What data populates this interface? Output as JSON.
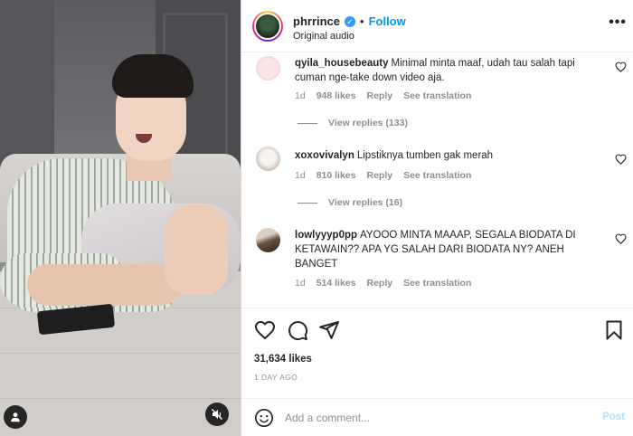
{
  "post": {
    "username": "phrrince",
    "separator": "•",
    "follow_label": "Follow",
    "audio": "Original audio",
    "more_icon": "more-horizontal-icon"
  },
  "comments": [
    {
      "username": "qyila_housebeauty",
      "text": "Minimal minta maaf, udah tau salah tapi cuman nge-take down video aja.",
      "time": "1d",
      "likes": "948 likes",
      "reply": "Reply",
      "translate": "See translation",
      "view_replies": "View replies (133)"
    },
    {
      "username": "xoxovivalyn",
      "text": "Lipstiknya tumben gak merah",
      "time": "1d",
      "likes": "810 likes",
      "reply": "Reply",
      "translate": "See translation",
      "view_replies": "View replies (16)"
    },
    {
      "username": "lowlyyyp0pp",
      "text": "AYOOO MINTA MAAAP, SEGALA BIODATA DI KETAWAIN?? APA YG SALAH DARI BIODATA NY? ANEH BANGET",
      "time": "1d",
      "likes": "514 likes",
      "reply": "Reply",
      "translate": "See translation"
    }
  ],
  "stats": {
    "likes": "31,634 likes",
    "time_ago": "1 DAY AGO"
  },
  "composer": {
    "placeholder": "Add a comment...",
    "post_label": "Post"
  },
  "colors": {
    "accent": "#0095f6",
    "post_disabled": "#b2dffc",
    "secondary_text": "#8e8e8e",
    "verified": "#3897f0"
  }
}
